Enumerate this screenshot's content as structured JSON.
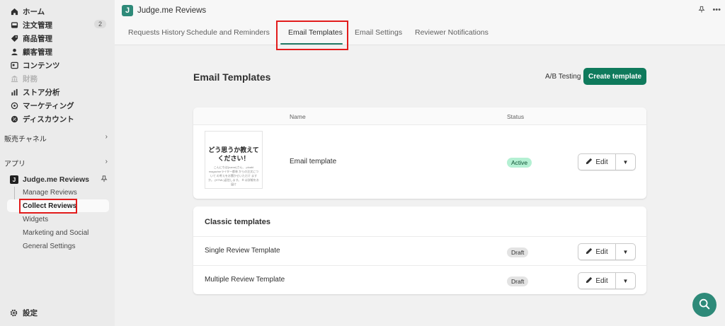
{
  "sidebar": {
    "items": [
      {
        "label": "ホーム"
      },
      {
        "label": "注文管理",
        "badge": "2"
      },
      {
        "label": "商品管理"
      },
      {
        "label": "顧客管理"
      },
      {
        "label": "コンテンツ"
      },
      {
        "label": "財務"
      },
      {
        "label": "ストア分析"
      },
      {
        "label": "マーケティング"
      },
      {
        "label": "ディスカウント"
      }
    ],
    "sales_channels": "販売チャネル",
    "apps": "アプリ",
    "app_name": "Judge.me Reviews",
    "app_logo_letter": "J",
    "sub_items": [
      "Manage Reviews",
      "Collect Reviews",
      "Widgets",
      "Marketing and Social",
      "General Settings"
    ],
    "settings": "設定"
  },
  "topbar": {
    "app_letter": "J",
    "title": "Judge.me Reviews"
  },
  "tabs": [
    "Requests History",
    "Schedule and Reminders",
    "Email Templates",
    "Email Settings",
    "Reviewer Notifications"
  ],
  "main": {
    "title": "Email Templates",
    "ab_testing": "A/B Testing",
    "create_button": "Create template",
    "table": {
      "col_name": "Name",
      "col_status": "Status",
      "rows": [
        {
          "name": "Email template",
          "status": "Active",
          "edit": "Edit"
        }
      ],
      "thumb_heading": "どう思うか教えてください！",
      "thumb_text": "こんにちは{name}さん、 ploabl magazineライター都林 からの注文について の考えをお聞かせいただけ ますか。 (HTML)返信します。 ※ は詳細をお届け"
    },
    "classic": {
      "title": "Classic templates",
      "rows": [
        {
          "name": "Single Review Template",
          "status": "Draft",
          "edit": "Edit"
        },
        {
          "name": "Multiple Review Template",
          "status": "Draft",
          "edit": "Edit"
        }
      ]
    }
  },
  "colors": {
    "accent": "#0f7a5c",
    "app_icon": "#2e8a79",
    "highlight": "#e21b1b"
  }
}
